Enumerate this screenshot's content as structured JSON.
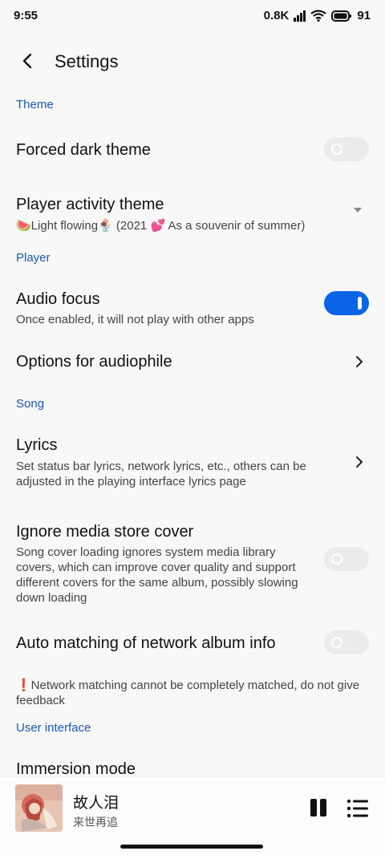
{
  "status": {
    "time": "9:55",
    "net_speed": "0.8K",
    "battery": "91"
  },
  "header": {
    "title": "Settings"
  },
  "sections": {
    "theme": "Theme",
    "player": "Player",
    "song": "Song",
    "ui": "User interface"
  },
  "items": {
    "forced_dark": {
      "title": "Forced dark theme",
      "enabled": false
    },
    "player_activity_theme": {
      "title": "Player activity theme",
      "value": "🍉Light flowing🍨 (2021 💕 As a souvenir of summer)"
    },
    "audio_focus": {
      "title": "Audio focus",
      "subtitle": "Once enabled, it will not play with other apps",
      "enabled": true
    },
    "audiophile": {
      "title": "Options for audiophile"
    },
    "lyrics": {
      "title": "Lyrics",
      "subtitle": "Set status bar lyrics, network lyrics, etc., others can be adjusted in the playing interface lyrics page"
    },
    "ignore_cover": {
      "title": "Ignore media store cover",
      "subtitle": "Song cover loading ignores system media library covers, which can improve cover quality and support different covers for the same album, possibly slowing down loading",
      "enabled": false
    },
    "auto_match": {
      "title": "Auto matching of network album info",
      "enabled": false,
      "note": "❗Network matching cannot be completely matched, do not give feedback"
    },
    "immersion": {
      "title": "Immersion mode"
    }
  },
  "now_playing": {
    "title": "故人泪",
    "artist": "来世再追"
  },
  "colors": {
    "accent": "#0b63e5",
    "section": "#1a56b8"
  }
}
